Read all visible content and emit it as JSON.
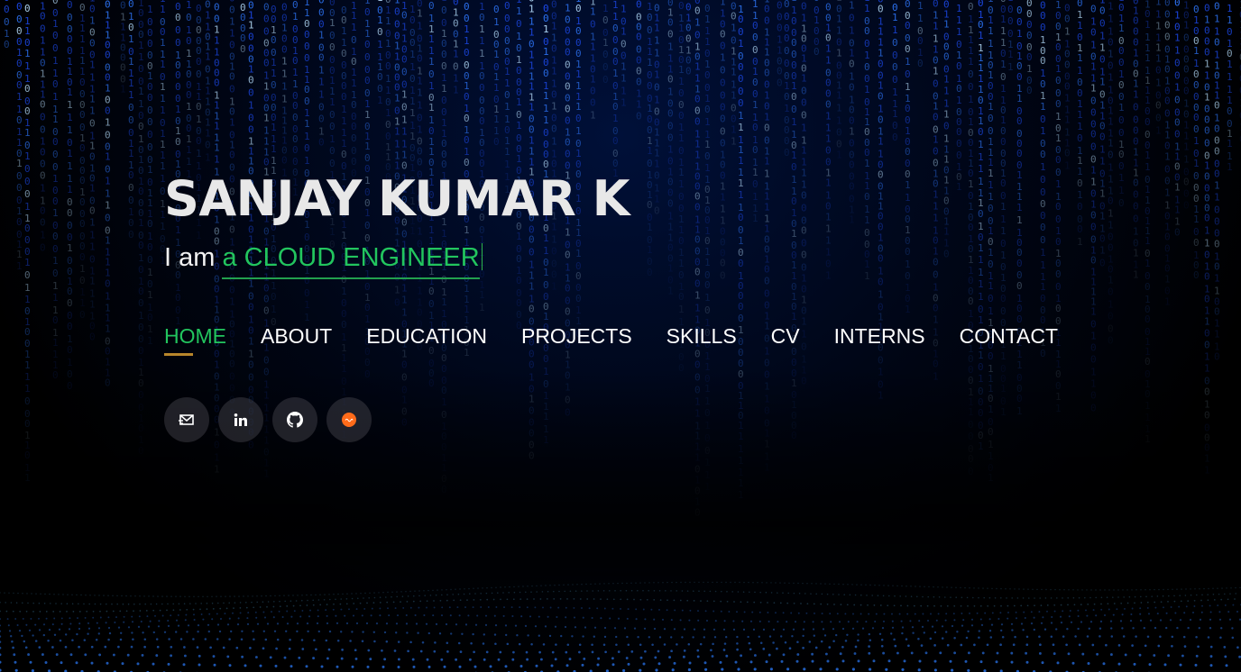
{
  "hero": {
    "name": "SANJAY KUMAR K",
    "tagline_prefix": "I am ",
    "tagline_role": "a CLOUD ENGINEER"
  },
  "nav": {
    "items": [
      {
        "label": "HOME",
        "active": true
      },
      {
        "label": "ABOUT",
        "active": false
      },
      {
        "label": "EDUCATION",
        "active": false
      },
      {
        "label": "PROJECTS",
        "active": false
      },
      {
        "label": "SKILLS",
        "active": false
      },
      {
        "label": "CV",
        "active": false
      },
      {
        "label": "INTERNS",
        "active": false
      },
      {
        "label": "CONTACT",
        "active": false
      }
    ]
  },
  "socials": [
    {
      "icon": "email-icon"
    },
    {
      "icon": "linkedin-icon"
    },
    {
      "icon": "github-icon"
    },
    {
      "icon": "credly-icon"
    }
  ],
  "colors": {
    "accent": "#22c55e",
    "nav_underline": "#b8862b",
    "rain": "#1e5bff",
    "background": "#000000"
  }
}
